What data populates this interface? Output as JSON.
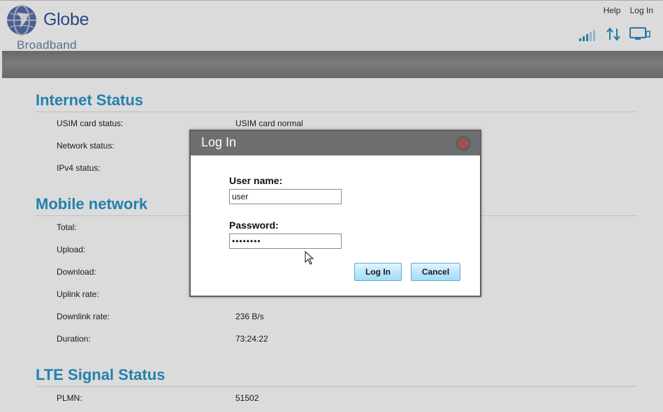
{
  "header": {
    "brand": "Globe",
    "sub_brand": "Broadband",
    "links": {
      "help": "Help",
      "login": "Log In"
    }
  },
  "icons": {
    "logo": "globe-logo-icon",
    "signal": "signal-strength-icon",
    "data": "up-down-arrows-icon",
    "device": "monitor-icon"
  },
  "colors": {
    "accent": "#2a97c9",
    "brand": "#2f5597",
    "button": "#bde7fb",
    "close": "#e22f2f"
  },
  "sections": {
    "internet": {
      "title": "Internet Status",
      "rows": [
        {
          "label": "USIM card status:",
          "value": "USIM card normal"
        },
        {
          "label": "Network status:",
          "value": ""
        },
        {
          "label": "IPv4 status:",
          "value": ""
        }
      ]
    },
    "mobile": {
      "title": "Mobile network",
      "rows": [
        {
          "label": "Total:",
          "value": ""
        },
        {
          "label": "Upload:",
          "value": ""
        },
        {
          "label": "Download:",
          "value": ""
        },
        {
          "label": "Uplink rate:",
          "value": ""
        },
        {
          "label": "Downlink rate:",
          "value": "236 B/s"
        },
        {
          "label": "Duration:",
          "value": "73:24:22"
        }
      ]
    },
    "lte": {
      "title": "LTE Signal Status",
      "rows": [
        {
          "label": "PLMN:",
          "value": "51502"
        }
      ]
    }
  },
  "dialog": {
    "title": "Log In",
    "username_label": "User name:",
    "username_value": "user",
    "password_label": "Password:",
    "password_value": "••••••••",
    "login_button": "Log In",
    "cancel_button": "Cancel"
  }
}
